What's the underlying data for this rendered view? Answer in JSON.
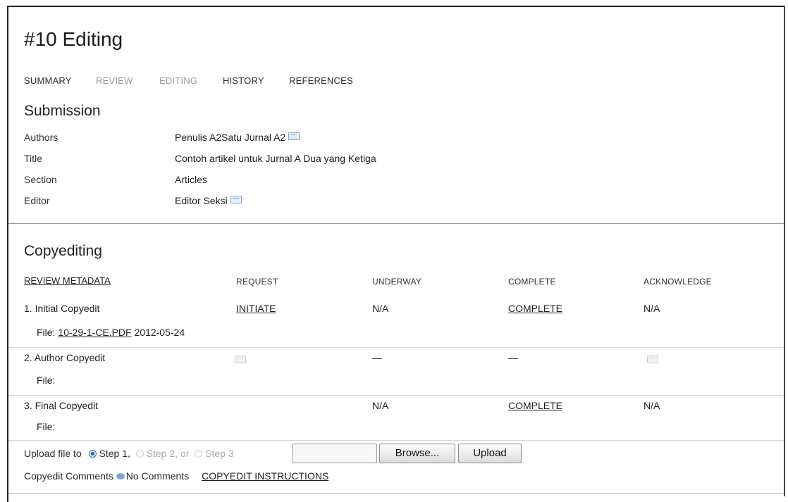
{
  "page": {
    "title": "#10 Editing"
  },
  "tabs": [
    {
      "label": "SUMMARY",
      "active": true
    },
    {
      "label": "REVIEW",
      "active": false
    },
    {
      "label": "EDITING",
      "active": false
    },
    {
      "label": "HISTORY",
      "active": true
    },
    {
      "label": "REFERENCES",
      "active": true
    }
  ],
  "submission": {
    "title": "Submission",
    "rows": [
      {
        "label": "Authors",
        "value": "Penulis A2Satu Jurnal A2",
        "email_icon": true
      },
      {
        "label": "Title",
        "value": "Contoh artikel untuk Jurnal A Dua yang Ketiga",
        "email_icon": false
      },
      {
        "label": "Section",
        "value": "Articles",
        "email_icon": false
      },
      {
        "label": "Editor",
        "value": "Editor Seksi",
        "email_icon": true
      }
    ]
  },
  "copyediting": {
    "title": "Copyediting",
    "review_metadata": "REVIEW METADATA",
    "headers": {
      "request": "REQUEST",
      "underway": "UNDERWAY",
      "complete": "COMPLETE",
      "acknowledge": "ACKNOWLEDGE"
    },
    "steps": [
      {
        "name": "1. Initial Copyedit",
        "file_label": "File:",
        "file_link": "10-29-1-CE.PDF",
        "file_date": "2012-05-24",
        "request": "INITIATE",
        "underway": "N/A",
        "complete": "COMPLETE",
        "acknowledge": "N/A"
      },
      {
        "name": "2. Author Copyedit",
        "file_label": "File:",
        "request_icon": "email-icon",
        "underway": "—",
        "complete": "—",
        "acknowledge_icon": "email-icon"
      },
      {
        "name": "3. Final Copyedit",
        "file_label": "File:",
        "underway": "N/A",
        "complete": "COMPLETE",
        "acknowledge": "N/A"
      }
    ],
    "upload": {
      "label": "Upload file to",
      "step1": "Step 1,",
      "step2": "Step 2, or",
      "step3": "Step 3",
      "browse": "Browse...",
      "upload": "Upload"
    },
    "comments": {
      "label": "Copyedit Comments",
      "value": "No Comments",
      "instructions": "COPYEDIT INSTRUCTIONS"
    }
  },
  "colors": {
    "link": "#222222",
    "inactive_tab": "#9a9a9a",
    "radio_checked": "#2a5ea8",
    "email_icon": "#8aa4c8"
  }
}
